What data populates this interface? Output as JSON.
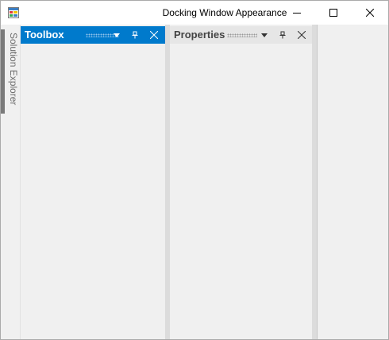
{
  "window": {
    "title": "Docking Window Appearance",
    "icon": "app-window-icon"
  },
  "title_bar_buttons": [
    "minimize-icon",
    "maximize-icon",
    "close-icon"
  ],
  "auto_hide_tabs": [
    {
      "label": "Solution Explorer",
      "active": false
    }
  ],
  "panels": [
    {
      "title": "Toolbox",
      "active": true,
      "buttons": [
        "dropdown-arrow-icon",
        "pin-icon",
        "close-icon"
      ]
    },
    {
      "title": "Properties",
      "active": false,
      "buttons": [
        "dropdown-arrow-icon",
        "pin-icon",
        "close-icon"
      ]
    }
  ],
  "colors": {
    "active_header": "#007acc",
    "inactive_header": "#e6e6e6",
    "background": "#f0f0f0",
    "auto_hide_tab_marker": "#7a7a7a"
  }
}
